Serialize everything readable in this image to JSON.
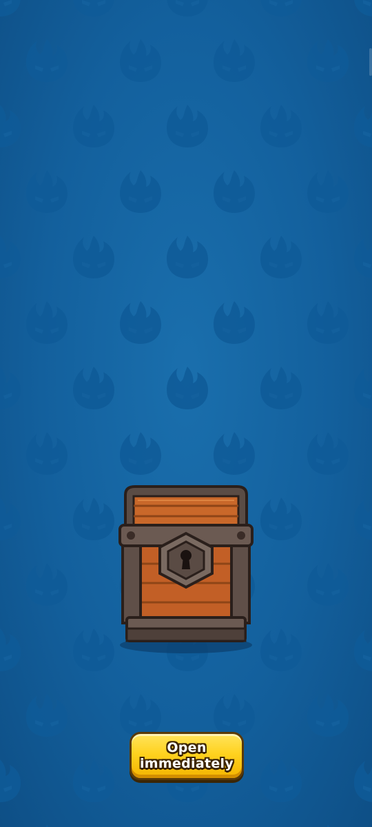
{
  "background": {
    "color": "#13609d",
    "pattern_icon": "flame-ghost-icon"
  },
  "chest": {
    "icon": "locked-treasure-chest-icon",
    "state": "locked"
  },
  "open_button": {
    "label": "Open immediately",
    "color": "#ffd21f"
  }
}
